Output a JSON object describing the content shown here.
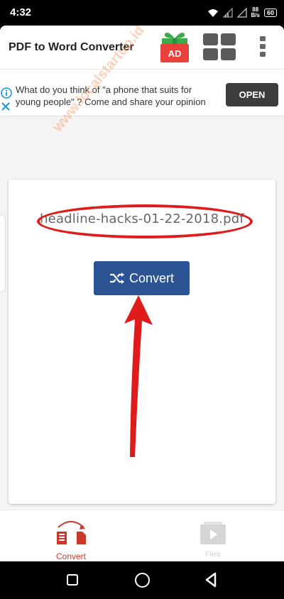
{
  "status_bar": {
    "time": "4:32",
    "net_speed_value": "88",
    "net_speed_unit": "B/s",
    "battery": "60"
  },
  "app": {
    "title": "PDF to Word Converter",
    "ad_badge": "AD"
  },
  "ad_banner": {
    "text": "What do you think of \"a phone that suits for young people\" ? Come and share your opinion",
    "open_label": "OPEN"
  },
  "watermark": {
    "text": "www.localstartup.id"
  },
  "main": {
    "file_name": "headline-hacks-01-22-2018.pdf",
    "convert_label": "Convert"
  },
  "bottom_nav": {
    "items": [
      {
        "label": "Convert",
        "active": true
      },
      {
        "label": "Files",
        "active": false
      }
    ]
  },
  "colors": {
    "primary_button": "#2c5494",
    "accent_red": "#c8392b",
    "annotation_red": "#e01b1b"
  }
}
